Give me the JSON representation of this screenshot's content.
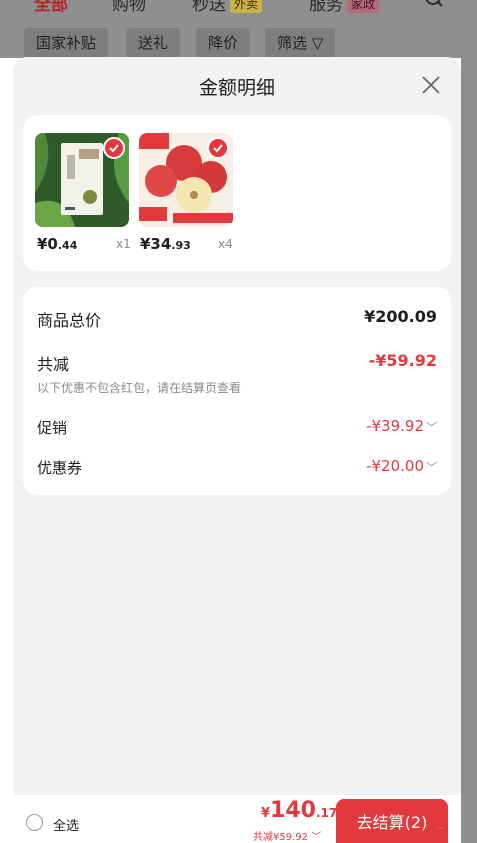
{
  "top_tabs": [
    {
      "label": "全部",
      "badge": ""
    },
    {
      "label": "购物",
      "badge": ""
    },
    {
      "label": "秒送",
      "badge": "外卖"
    },
    {
      "label": "服务",
      "badge": "家政"
    }
  ],
  "filters": [
    "国家补贴",
    "送礼",
    "降价",
    "筛选 ▽"
  ],
  "sheet": {
    "title": "金额明细"
  },
  "products": [
    {
      "price_int": "¥0",
      "price_dec": ".44",
      "qty": "x1"
    },
    {
      "price_int": "¥34",
      "price_dec": ".93",
      "qty": "x4"
    }
  ],
  "summary": {
    "total_label": "商品总价",
    "total_value": "¥200.09",
    "discount_label": "共减",
    "discount_value": "-¥59.92",
    "note": "以下优惠不包含红包，请在结算页查看",
    "promo_label": "促销",
    "promo_value": "-¥39.92",
    "coupon_label": "优惠券",
    "coupon_value": "-¥20.00"
  },
  "bottom": {
    "select_all": "全选",
    "yen": "¥",
    "total_int": "140",
    "total_dec": ".17",
    "saved": "共减¥59.92",
    "checkout": "去结算(2)"
  },
  "colors": {
    "accent": "#e4393c",
    "overlay": "#8f8f8f"
  }
}
